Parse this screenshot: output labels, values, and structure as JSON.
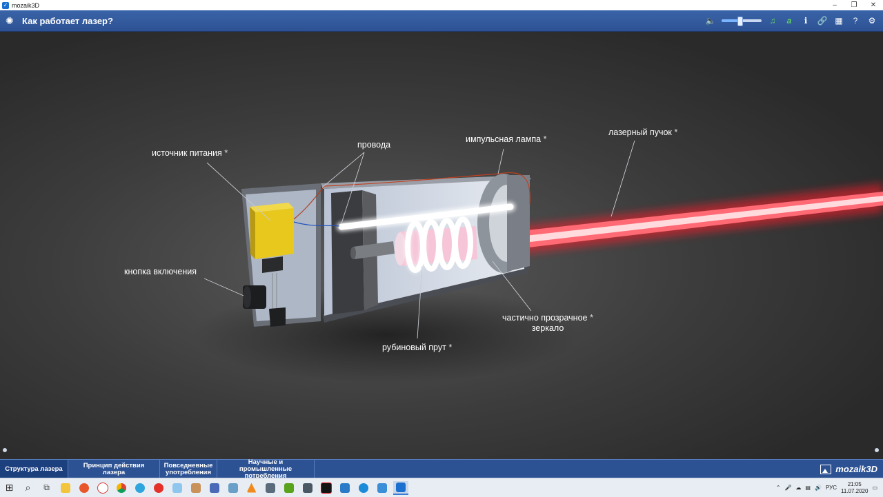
{
  "window": {
    "title": "mozaik3D",
    "controls": {
      "minimize": "–",
      "restore": "❐",
      "close": "✕"
    }
  },
  "appbar": {
    "menu_icon": "✺",
    "title": "Как работает лазер?",
    "volume_level": 0.45,
    "tools": {
      "volume": "🔈",
      "music": "♫",
      "text": "a",
      "info": "ℹ",
      "link": "🔗",
      "grid": "▦",
      "help": "?",
      "settings": "⚙"
    }
  },
  "scene": {
    "labels": {
      "power_source": "источник питания",
      "wires": "провода",
      "flash_lamp": "импульсная лампа",
      "laser_beam": "лазерный пучок",
      "power_button": "кнопка включения",
      "partial_mirror_line1": "частично прозрачное",
      "partial_mirror_line2": "зеркало",
      "ruby_rod": "рубиновый прут"
    },
    "star": "*"
  },
  "tabs": {
    "items": [
      {
        "label": "Структура лазера"
      },
      {
        "label": "Принцип действия лазера"
      },
      {
        "label": "Повседневные употребления"
      },
      {
        "label": "Научные и промышленные потребления"
      }
    ],
    "brand": "mozaik3D"
  },
  "taskbar": {
    "start": "⊞",
    "search": "⌕",
    "taskview": "⧉",
    "tray": {
      "lang": "РУС",
      "time": "21:05",
      "date": "11.07.2020",
      "notification": "▭"
    }
  },
  "colors": {
    "accent": "#2d5294",
    "beam": "#ff2a3a",
    "power_box": "#e8c81c"
  }
}
